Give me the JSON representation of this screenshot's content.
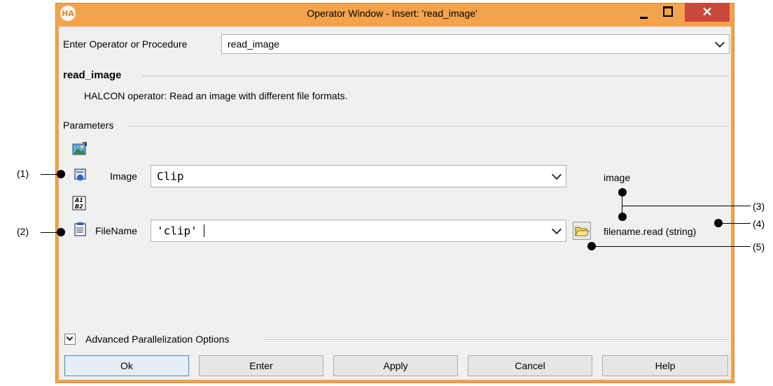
{
  "window": {
    "app_icon_text": "HA",
    "title": "Operator Window - Insert: 'read_image'",
    "close_glyph": "✕"
  },
  "operator_entry": {
    "label": "Enter Operator or Procedure",
    "value": "read_image"
  },
  "operator_info": {
    "name": "read_image",
    "description": "HALCON operator:  Read an image with different file formats."
  },
  "parameters": {
    "heading": "Parameters",
    "items": [
      {
        "label": "Image",
        "value": "Clip",
        "type_info": "image"
      },
      {
        "label": "FileName",
        "value": "'clip'",
        "type_info": "filename.read (string)"
      }
    ]
  },
  "advanced": {
    "label": "Advanced Parallelization Options"
  },
  "buttons": {
    "ok": "Ok",
    "enter": "Enter",
    "apply": "Apply",
    "cancel": "Cancel",
    "help": "Help"
  },
  "annotations": {
    "c1": "(1)",
    "c2": "(2)",
    "c3": "(3)",
    "c4": "(4)",
    "c5": "(5)"
  },
  "icons": {
    "output_param_group": "image-output-icon",
    "control_param_group": "control-data-icon",
    "image_param": "iconic-parameter-icon",
    "filename_param": "control-parameter-icon",
    "browse": "folder-open-icon",
    "advanced_toggle": "chevron-down-icon"
  }
}
